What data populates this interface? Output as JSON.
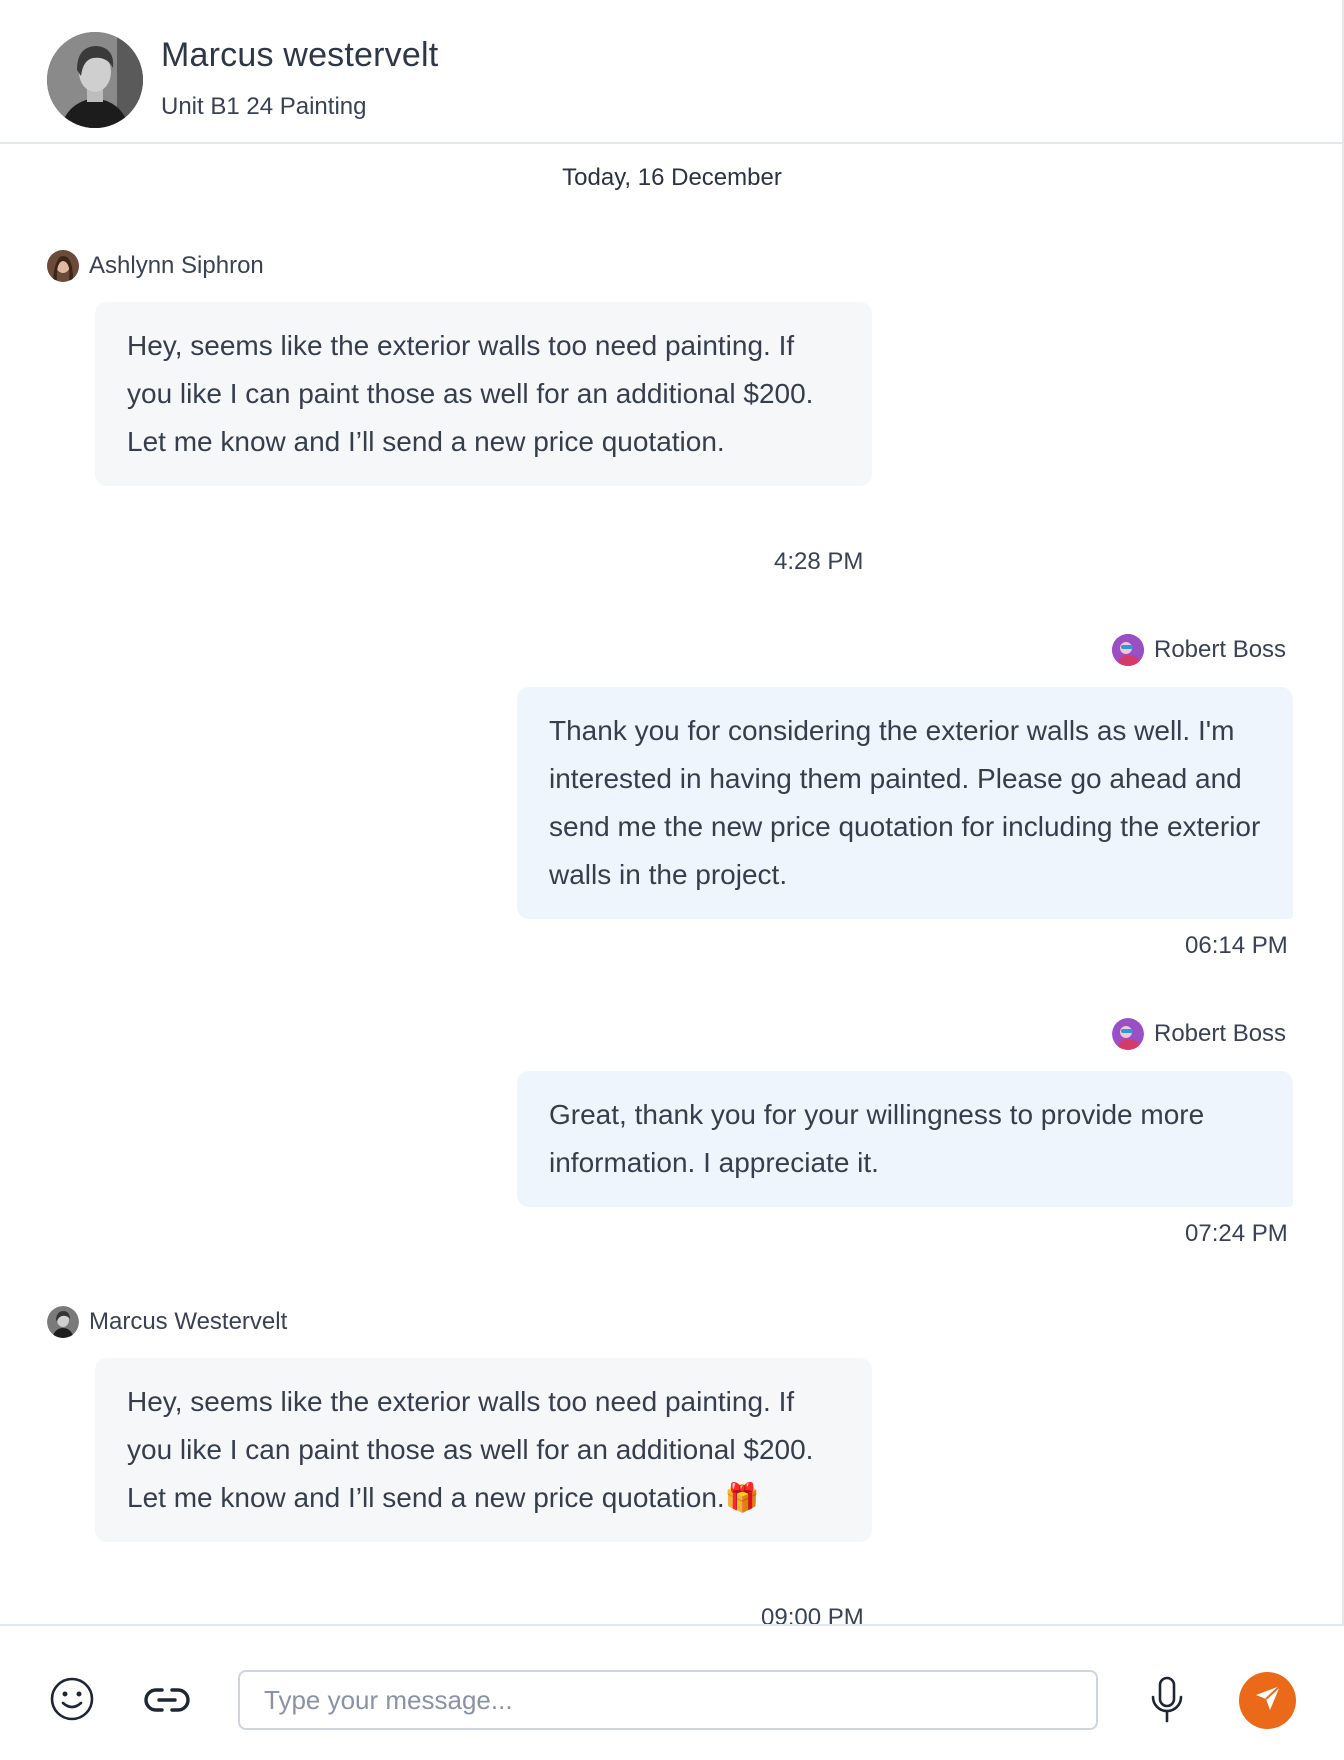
{
  "header": {
    "name": "Marcus westervelt",
    "subtitle": "Unit B1 24 Painting"
  },
  "chat": {
    "date_divider": "Today, 16 December",
    "messages": [
      {
        "sender": "Ashlynn Siphron",
        "direction": "incoming",
        "text": "Hey, seems like the exterior walls too need painting. If you like I can paint those as well for an additional $200. Let me know and I’ll send a new price quotation.",
        "time": "4:28 PM"
      },
      {
        "sender": "Robert Boss",
        "direction": "outgoing",
        "text": "Thank you for considering the exterior walls as well. I'm interested in having them painted. Please go ahead and send me the new price quotation for including the exterior walls in the project.",
        "time": "06:14 PM"
      },
      {
        "sender": "Robert Boss",
        "direction": "outgoing",
        "text": "Great, thank you for your willingness to provide more information. I appreciate it.",
        "time": "07:24 PM"
      },
      {
        "sender": "Marcus Westervelt",
        "direction": "incoming",
        "text": "Hey, seems like the exterior walls too need painting. If you like I can paint those as well for an additional $200. Let me know and I’ll send a new price quotation.🎁",
        "time": "09:00 PM"
      }
    ]
  },
  "composer": {
    "placeholder": "Type your message...",
    "icons": [
      "emoji-icon",
      "link-icon",
      "microphone-icon",
      "send-icon"
    ]
  },
  "colors": {
    "send_button": "#ea6a1a",
    "incoming_bubble": "#f6f7f9",
    "outgoing_bubble": "#eef5fd",
    "divider": "#e3e7ee"
  }
}
